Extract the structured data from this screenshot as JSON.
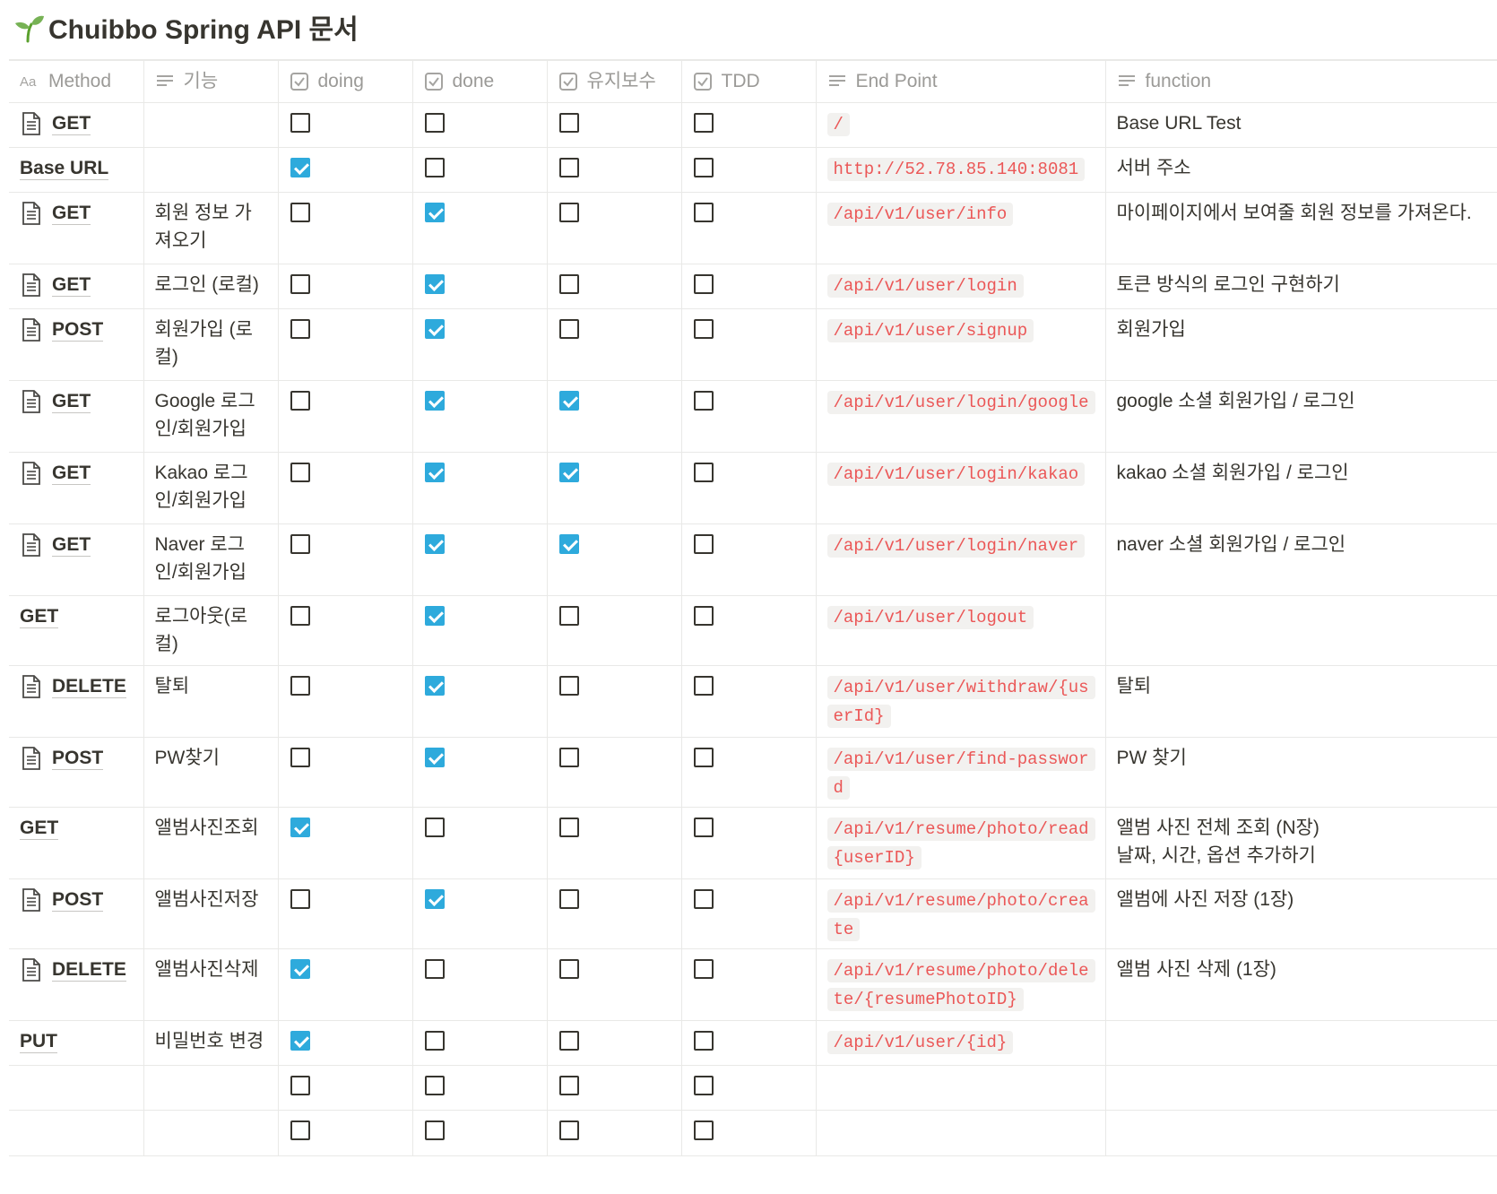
{
  "page_title": "Chuibbo Spring API 문서",
  "icons": {
    "title": "sprout-emoji",
    "title_prefix": "Aa",
    "text_column": "text-lines-icon",
    "checkbox_column": "checkbox-icon",
    "row_page": "page-icon"
  },
  "colors": {
    "checked": "#2eaadc",
    "code_text": "#eb5757",
    "code_bg": "#f2f1ef",
    "header_text": "#9b9a97"
  },
  "columns": [
    {
      "label": "Method",
      "type": "title"
    },
    {
      "label": "기능",
      "type": "text"
    },
    {
      "label": "doing",
      "type": "checkbox"
    },
    {
      "label": "done",
      "type": "checkbox"
    },
    {
      "label": "유지보수",
      "type": "checkbox"
    },
    {
      "label": "TDD",
      "type": "checkbox"
    },
    {
      "label": "End Point",
      "type": "text"
    },
    {
      "label": "function",
      "type": "text"
    }
  ],
  "rows": [
    {
      "method": "GET",
      "icon": true,
      "feature": "",
      "doing": false,
      "done": false,
      "maint": false,
      "tdd": false,
      "endpoint": "/",
      "function": "Base URL Test"
    },
    {
      "method": "Base URL",
      "icon": false,
      "feature": "",
      "doing": true,
      "done": false,
      "maint": false,
      "tdd": false,
      "endpoint": "http://52.78.85.140:8081",
      "function": "서버 주소"
    },
    {
      "method": "GET",
      "icon": true,
      "feature": "회원 정보 가져오기",
      "doing": false,
      "done": true,
      "maint": false,
      "tdd": false,
      "endpoint": "/api/v1/user/info",
      "function": "마이페이지에서 보여줄 회원 정보를 가져온다."
    },
    {
      "method": "GET",
      "icon": true,
      "feature": "로그인 (로컬)",
      "doing": false,
      "done": true,
      "maint": false,
      "tdd": false,
      "endpoint": "/api/v1/user/login",
      "function": "토큰 방식의 로그인 구현하기"
    },
    {
      "method": "POST",
      "icon": true,
      "feature": "회원가입 (로컬)",
      "doing": false,
      "done": true,
      "maint": false,
      "tdd": false,
      "endpoint": "/api/v1/user/signup",
      "function": "회원가입"
    },
    {
      "method": "GET",
      "icon": true,
      "feature": "Google 로그인/회원가입",
      "doing": false,
      "done": true,
      "maint": true,
      "tdd": false,
      "endpoint": "/api/v1/user/login/google",
      "function": "google 소셜 회원가입 / 로그인"
    },
    {
      "method": "GET",
      "icon": true,
      "feature": "Kakao 로그인/회원가입",
      "doing": false,
      "done": true,
      "maint": true,
      "tdd": false,
      "endpoint": "/api/v1/user/login/kakao",
      "function": "kakao 소셜 회원가입 / 로그인"
    },
    {
      "method": "GET",
      "icon": true,
      "feature": "Naver 로그인/회원가입",
      "doing": false,
      "done": true,
      "maint": true,
      "tdd": false,
      "endpoint": "/api/v1/user/login/naver",
      "function": "naver 소셜 회원가입 / 로그인"
    },
    {
      "method": "GET",
      "icon": false,
      "feature": "로그아웃(로컬)",
      "doing": false,
      "done": true,
      "maint": false,
      "tdd": false,
      "endpoint": "/api/v1/user/logout",
      "function": ""
    },
    {
      "method": "DELETE",
      "icon": true,
      "feature": "탈퇴",
      "doing": false,
      "done": true,
      "maint": false,
      "tdd": false,
      "endpoint": "/api/v1/user/withdraw/{userId}",
      "function": "탈퇴"
    },
    {
      "method": "POST",
      "icon": true,
      "feature": "PW찾기",
      "doing": false,
      "done": true,
      "maint": false,
      "tdd": false,
      "endpoint": "/api/v1/user/find-password",
      "function": "PW 찾기"
    },
    {
      "method": "GET",
      "icon": false,
      "feature": "앨범사진조회",
      "doing": true,
      "done": false,
      "maint": false,
      "tdd": false,
      "endpoint": "/api/v1/resume/photo/read{userID}",
      "function": "앨범 사진 전체 조회 (N장)\n날짜, 시간, 옵션 추가하기"
    },
    {
      "method": "POST",
      "icon": true,
      "feature": "앨범사진저장",
      "doing": false,
      "done": true,
      "maint": false,
      "tdd": false,
      "endpoint": "/api/v1/resume/photo/create",
      "function": "앨범에 사진 저장 (1장)"
    },
    {
      "method": "DELETE",
      "icon": true,
      "feature": "앨범사진삭제",
      "doing": true,
      "done": false,
      "maint": false,
      "tdd": false,
      "endpoint": "/api/v1/resume/photo/delete/{resumePhotoID}",
      "function": "앨범 사진 삭제 (1장)"
    },
    {
      "method": "PUT",
      "icon": false,
      "feature": "비밀번호 변경",
      "doing": true,
      "done": false,
      "maint": false,
      "tdd": false,
      "endpoint": "/api/v1/user/{id}",
      "function": ""
    },
    {
      "method": "",
      "icon": false,
      "feature": "",
      "doing": false,
      "done": false,
      "maint": false,
      "tdd": false,
      "endpoint": "",
      "function": ""
    },
    {
      "method": "",
      "icon": false,
      "feature": "",
      "doing": false,
      "done": false,
      "maint": false,
      "tdd": false,
      "endpoint": "",
      "function": ""
    }
  ]
}
